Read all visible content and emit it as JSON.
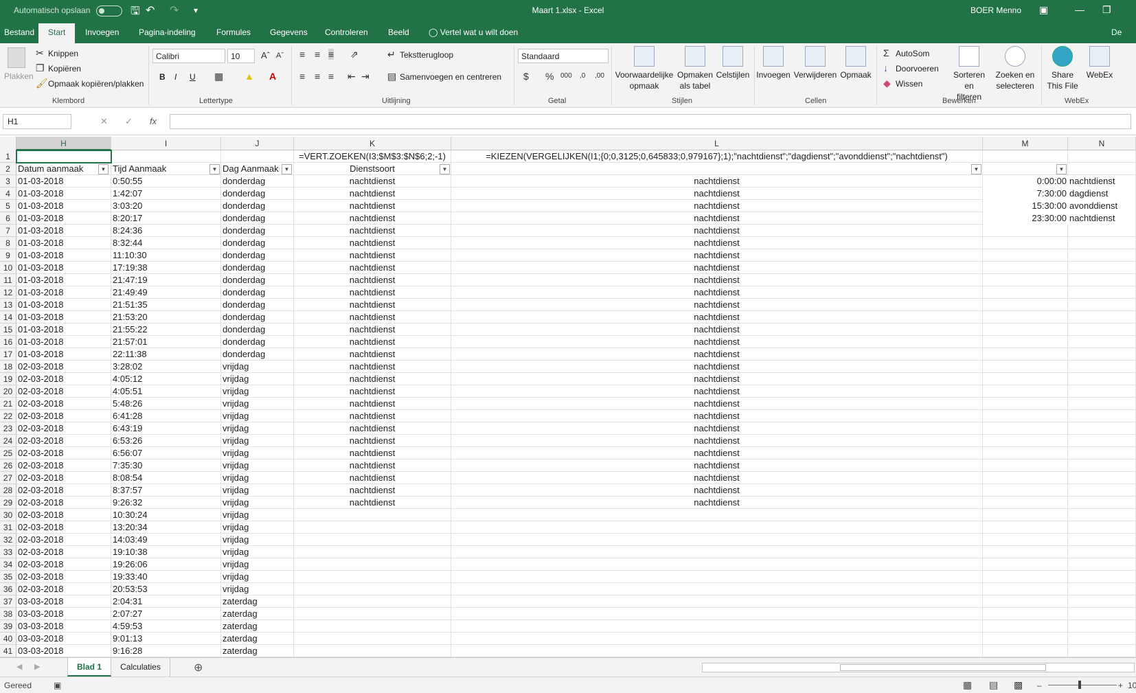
{
  "titlebar": {
    "autosave_label": "Automatisch opslaan",
    "document_title": "Maart 1.xlsx  -  Excel",
    "user": "BOER Menno"
  },
  "menu": {
    "tabs": [
      "Bestand",
      "Start",
      "Invoegen",
      "Pagina-indeling",
      "Formules",
      "Gegevens",
      "Controleren",
      "Beeld"
    ],
    "active_tab": "Start",
    "tell_me": "Vertel wat u wilt doen",
    "share_cut": "De"
  },
  "ribbon": {
    "clipboard": {
      "paste": "Plakken",
      "cut": "Knippen",
      "copy": "Kopiëren",
      "format_painter": "Opmaak kopiëren/plakken",
      "label": "Klembord"
    },
    "font": {
      "font_name": "Calibri",
      "font_size": "10",
      "bold": "B",
      "italic": "I",
      "underline": "U",
      "label": "Lettertype"
    },
    "alignment": {
      "wrap_text": "Tekstterugloop",
      "merge_center": "Samenvoegen en centreren",
      "label": "Uitlijning"
    },
    "number": {
      "format": "Standaard",
      "label": "Getal"
    },
    "styles": {
      "conditional_1": "Voorwaardelijke",
      "conditional_2": "opmaak",
      "as_table_1": "Opmaken",
      "as_table_2": "als tabel",
      "cell_styles": "Celstijlen",
      "label": "Stijlen"
    },
    "cells": {
      "insert": "Invoegen",
      "delete": "Verwijderen",
      "format": "Opmaak",
      "label": "Cellen"
    },
    "editing": {
      "autosum": "AutoSom",
      "fill": "Doorvoeren",
      "clear": "Wissen",
      "sort_1": "Sorteren en",
      "sort_2": "filteren",
      "find_1": "Zoeken en",
      "find_2": "selecteren",
      "label": "Bewerken"
    },
    "webex": {
      "share_1": "Share",
      "share_2": "This File",
      "webex": "WebEx",
      "label": "WebEx"
    }
  },
  "formula_bar": {
    "name_box": "H1",
    "formula": ""
  },
  "columns": [
    "H",
    "I",
    "J",
    "K",
    "L",
    "M",
    "N"
  ],
  "selected_column": "H",
  "row1": {
    "K": "=VERT.ZOEKEN(I3;$M$3:$N$6;2;-1)",
    "L": "=KIEZEN(VERGELIJKEN(I1;{0;0,3125;0,645833;0,979167};1);\"nachtdienst\";\"dagdienst\";\"avonddienst\";\"nachtdienst\")"
  },
  "headers": {
    "H": "Datum aanmaak",
    "I": "Tijd Aanmaak",
    "J": "Dag Aanmaak",
    "K": "Dienstsoort"
  },
  "lookup_table": [
    {
      "time": "0:00:00",
      "shift": "nachtdienst"
    },
    {
      "time": "7:30:00",
      "shift": "dagdienst"
    },
    {
      "time": "15:30:00",
      "shift": "avonddienst"
    },
    {
      "time": "23:30:00",
      "shift": "nachtdienst"
    }
  ],
  "rows": [
    {
      "n": "3",
      "date": "01-03-2018",
      "time": "0:50:55",
      "day": "donderdag",
      "k": "nachtdienst",
      "l": "nachtdienst"
    },
    {
      "n": "4",
      "date": "01-03-2018",
      "time": "1:42:07",
      "day": "donderdag",
      "k": "nachtdienst",
      "l": "nachtdienst"
    },
    {
      "n": "5",
      "date": "01-03-2018",
      "time": "3:03:20",
      "day": "donderdag",
      "k": "nachtdienst",
      "l": "nachtdienst"
    },
    {
      "n": "6",
      "date": "01-03-2018",
      "time": "8:20:17",
      "day": "donderdag",
      "k": "nachtdienst",
      "l": "nachtdienst"
    },
    {
      "n": "7",
      "date": "01-03-2018",
      "time": "8:24:36",
      "day": "donderdag",
      "k": "nachtdienst",
      "l": "nachtdienst"
    },
    {
      "n": "8",
      "date": "01-03-2018",
      "time": "8:32:44",
      "day": "donderdag",
      "k": "nachtdienst",
      "l": "nachtdienst"
    },
    {
      "n": "9",
      "date": "01-03-2018",
      "time": "11:10:30",
      "day": "donderdag",
      "k": "nachtdienst",
      "l": "nachtdienst"
    },
    {
      "n": "10",
      "date": "01-03-2018",
      "time": "17:19:38",
      "day": "donderdag",
      "k": "nachtdienst",
      "l": "nachtdienst"
    },
    {
      "n": "11",
      "date": "01-03-2018",
      "time": "21:47:19",
      "day": "donderdag",
      "k": "nachtdienst",
      "l": "nachtdienst"
    },
    {
      "n": "12",
      "date": "01-03-2018",
      "time": "21:49:49",
      "day": "donderdag",
      "k": "nachtdienst",
      "l": "nachtdienst"
    },
    {
      "n": "13",
      "date": "01-03-2018",
      "time": "21:51:35",
      "day": "donderdag",
      "k": "nachtdienst",
      "l": "nachtdienst"
    },
    {
      "n": "14",
      "date": "01-03-2018",
      "time": "21:53:20",
      "day": "donderdag",
      "k": "nachtdienst",
      "l": "nachtdienst"
    },
    {
      "n": "15",
      "date": "01-03-2018",
      "time": "21:55:22",
      "day": "donderdag",
      "k": "nachtdienst",
      "l": "nachtdienst"
    },
    {
      "n": "16",
      "date": "01-03-2018",
      "time": "21:57:01",
      "day": "donderdag",
      "k": "nachtdienst",
      "l": "nachtdienst"
    },
    {
      "n": "17",
      "date": "01-03-2018",
      "time": "22:11:38",
      "day": "donderdag",
      "k": "nachtdienst",
      "l": "nachtdienst"
    },
    {
      "n": "18",
      "date": "02-03-2018",
      "time": "3:28:02",
      "day": "vrijdag",
      "k": "nachtdienst",
      "l": "nachtdienst"
    },
    {
      "n": "19",
      "date": "02-03-2018",
      "time": "4:05:12",
      "day": "vrijdag",
      "k": "nachtdienst",
      "l": "nachtdienst"
    },
    {
      "n": "20",
      "date": "02-03-2018",
      "time": "4:05:51",
      "day": "vrijdag",
      "k": "nachtdienst",
      "l": "nachtdienst"
    },
    {
      "n": "21",
      "date": "02-03-2018",
      "time": "5:48:26",
      "day": "vrijdag",
      "k": "nachtdienst",
      "l": "nachtdienst"
    },
    {
      "n": "22",
      "date": "02-03-2018",
      "time": "6:41:28",
      "day": "vrijdag",
      "k": "nachtdienst",
      "l": "nachtdienst"
    },
    {
      "n": "23",
      "date": "02-03-2018",
      "time": "6:43:19",
      "day": "vrijdag",
      "k": "nachtdienst",
      "l": "nachtdienst"
    },
    {
      "n": "24",
      "date": "02-03-2018",
      "time": "6:53:26",
      "day": "vrijdag",
      "k": "nachtdienst",
      "l": "nachtdienst"
    },
    {
      "n": "25",
      "date": "02-03-2018",
      "time": "6:56:07",
      "day": "vrijdag",
      "k": "nachtdienst",
      "l": "nachtdienst"
    },
    {
      "n": "26",
      "date": "02-03-2018",
      "time": "7:35:30",
      "day": "vrijdag",
      "k": "nachtdienst",
      "l": "nachtdienst"
    },
    {
      "n": "27",
      "date": "02-03-2018",
      "time": "8:08:54",
      "day": "vrijdag",
      "k": "nachtdienst",
      "l": "nachtdienst"
    },
    {
      "n": "28",
      "date": "02-03-2018",
      "time": "8:37:57",
      "day": "vrijdag",
      "k": "nachtdienst",
      "l": "nachtdienst"
    },
    {
      "n": "29",
      "date": "02-03-2018",
      "time": "9:26:32",
      "day": "vrijdag",
      "k": "nachtdienst",
      "l": "nachtdienst"
    },
    {
      "n": "30",
      "date": "02-03-2018",
      "time": "10:30:24",
      "day": "vrijdag",
      "k": "",
      "l": ""
    },
    {
      "n": "31",
      "date": "02-03-2018",
      "time": "13:20:34",
      "day": "vrijdag",
      "k": "",
      "l": ""
    },
    {
      "n": "32",
      "date": "02-03-2018",
      "time": "14:03:49",
      "day": "vrijdag",
      "k": "",
      "l": ""
    },
    {
      "n": "33",
      "date": "02-03-2018",
      "time": "19:10:38",
      "day": "vrijdag",
      "k": "",
      "l": ""
    },
    {
      "n": "34",
      "date": "02-03-2018",
      "time": "19:26:06",
      "day": "vrijdag",
      "k": "",
      "l": ""
    },
    {
      "n": "35",
      "date": "02-03-2018",
      "time": "19:33:40",
      "day": "vrijdag",
      "k": "",
      "l": ""
    },
    {
      "n": "36",
      "date": "02-03-2018",
      "time": "20:53:53",
      "day": "vrijdag",
      "k": "",
      "l": ""
    },
    {
      "n": "37",
      "date": "03-03-2018",
      "time": "2:04:31",
      "day": "zaterdag",
      "k": "",
      "l": ""
    },
    {
      "n": "38",
      "date": "03-03-2018",
      "time": "2:07:27",
      "day": "zaterdag",
      "k": "",
      "l": ""
    },
    {
      "n": "39",
      "date": "03-03-2018",
      "time": "4:59:53",
      "day": "zaterdag",
      "k": "",
      "l": ""
    },
    {
      "n": "40",
      "date": "03-03-2018",
      "time": "9:01:13",
      "day": "zaterdag",
      "k": "",
      "l": ""
    },
    {
      "n": "41",
      "date": "03-03-2018",
      "time": "9:16:28",
      "day": "zaterdag",
      "k": "",
      "l": ""
    }
  ],
  "sheets": [
    "Blad 1",
    "Calculaties"
  ],
  "active_sheet": "Blad 1",
  "status": {
    "ready": "Gereed",
    "zoom": "10"
  },
  "colors": {
    "excel_green": "#217346",
    "ribbon_bg": "#f3f3f3",
    "gridline": "#e1e1e1"
  },
  "icons": [
    "save-icon",
    "undo-icon",
    "redo-icon",
    "lightbulb-icon",
    "paste-icon",
    "scissors-icon",
    "copy-icon",
    "brush-icon",
    "sigma-icon",
    "filter-dropdown-icon",
    "plus-icon"
  ]
}
